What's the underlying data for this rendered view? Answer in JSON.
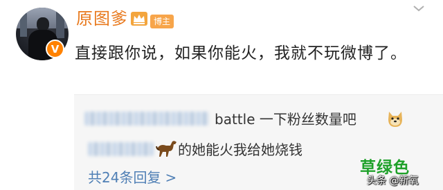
{
  "post": {
    "username": "原图爹",
    "role_badge": "博主",
    "text": "直接跟你说，如果你能火，我就不玩微博了。"
  },
  "replies": [
    {
      "text": "battle 一下粉丝数量吧",
      "emoji": "doge-icon"
    },
    {
      "text": "的她能火我给她烧钱",
      "emoji": "horse-icon"
    }
  ],
  "reply_count": "共24条回复",
  "reply_arrow": ">",
  "watermark": {
    "label": "草绿色",
    "source": "头条 @新氧"
  },
  "colors": {
    "username": "#e8791d",
    "verified": "#ff8200",
    "link": "#4f7fb5",
    "watermark": "#1fa12a"
  }
}
